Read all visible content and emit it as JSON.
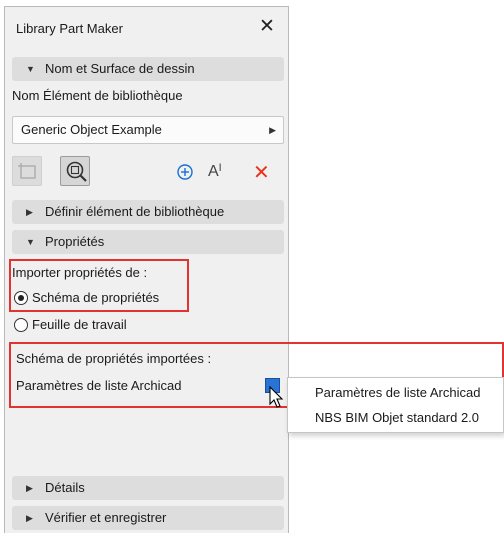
{
  "window": {
    "title": "Library Part Maker",
    "close_glyph": "✕"
  },
  "sections": {
    "nom_surface": "Nom et Surface de dessin",
    "definir": "Définir élément de bibliothèque",
    "proprietes": "Propriétés",
    "details": "Détails",
    "verifier": "Vérifier et enregistrer"
  },
  "nom_element": {
    "label": "Nom Élément de bibliothèque",
    "selected": "Generic Object Example"
  },
  "toolbar": {
    "icons": [
      "rect-select-icon",
      "zoom-select-icon",
      "add-icon",
      "text-size-icon",
      "delete-icon"
    ],
    "text_icon_glyph": "AI",
    "delete_glyph": "✕",
    "add_glyph": "⊕"
  },
  "import_props": {
    "label": "Importer propriétés de :",
    "options": [
      "Schéma de propriétés",
      "Feuille de travail"
    ],
    "selected": "Schéma de propriétés"
  },
  "schema_imported": {
    "label": "Schéma de propriétés importées :",
    "value": "Paramètres de liste Archicad"
  },
  "popup_menu": {
    "items": [
      "Paramètres de liste Archicad",
      "NBS BIM Objet standard 2.0"
    ]
  },
  "colors": {
    "highlight_red": "#e23232",
    "accent_blue": "#1a6fd4",
    "delete_red": "#e8341c",
    "panel_bg": "#f0f0f0",
    "section_bg": "#dddddd"
  }
}
